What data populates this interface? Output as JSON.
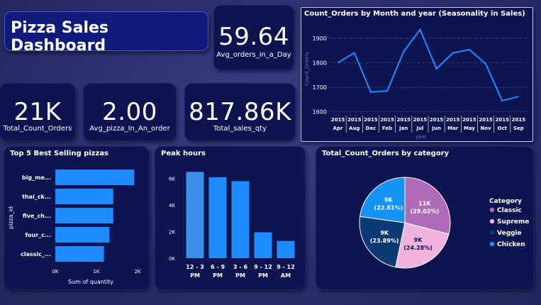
{
  "dashboard_title": "Pizza Sales Dashboard",
  "kpis": {
    "avg_orders_day": {
      "value": "59.64",
      "label": "Avg_orders_in_a_Day"
    },
    "total_orders": {
      "value": "21K",
      "label": "Total_Count_Orders"
    },
    "avg_pizza_order": {
      "value": "2.00",
      "label": "Avg_pizza_In_An_order"
    },
    "total_sales_qty": {
      "value": "817.86K",
      "label": "Total_sales_qty"
    }
  },
  "colors": {
    "bar": "#1e8cff",
    "bar_peak": "#3b8fe8",
    "classic": "#b06bb8",
    "supreme": "#f0b3dd",
    "veggie": "#0c3a75",
    "chicken": "#1592f5",
    "line": "#1e8cff"
  },
  "chart_data": [
    {
      "type": "line",
      "title": "Count_Orders by Month and year (Seasonality in Sales)",
      "x_year": [
        "2015",
        "2015",
        "2015",
        "2015",
        "2015",
        "2015",
        "2015",
        "2015",
        "2015",
        "2015",
        "2015",
        "2015"
      ],
      "x": [
        "Apr",
        "Aug",
        "Dec",
        "Feb",
        "Jan",
        "Jul",
        "Jun",
        "Mar",
        "May",
        "Nov",
        "Oct",
        "Sep"
      ],
      "values": [
        1800,
        1840,
        1680,
        1685,
        1845,
        1935,
        1775,
        1840,
        1853,
        1795,
        1645,
        1662
      ],
      "yticks": [
        1600,
        1700,
        1800,
        1900
      ],
      "ylim": [
        1590,
        1960
      ],
      "xlabel": "year",
      "ylabel": "Count_Orders"
    },
    {
      "type": "bar",
      "orientation": "horizontal",
      "title": "Top 5 Best Selling pizzas",
      "categories": [
        "big_me...",
        "thai_ck...",
        "five_ch...",
        "four_c...",
        "classic_..."
      ],
      "values": [
        1914,
        1410,
        1409,
        1316,
        1181
      ],
      "xticks": [
        "0K",
        "1K",
        "2K"
      ],
      "xlim": [
        0,
        2000
      ],
      "xlabel": "Sum of quantity",
      "ylabel": "pizza_id"
    },
    {
      "type": "bar",
      "title": "Peak hours",
      "categories": [
        [
          "12 - 3",
          "PM"
        ],
        [
          "6 - 9",
          "PM"
        ],
        [
          "3 - 6",
          "PM"
        ],
        [
          "9 - 12",
          "PM"
        ],
        [
          "9 - 12",
          "AM"
        ]
      ],
      "values": [
        6500,
        6100,
        5800,
        1950,
        1300
      ],
      "yticks": [
        "0K",
        "2K",
        "4K",
        "6K"
      ],
      "ylim": [
        0,
        7000
      ]
    },
    {
      "type": "pie",
      "title": "Total_Count_Orders by category",
      "legend_title": "Category",
      "slices": [
        {
          "name": "Classic",
          "value": 29.02,
          "label1": "11K",
          "label2": "(29.02%)"
        },
        {
          "name": "Supreme",
          "value": 24.28,
          "label1": "9K",
          "label2": "(24.28%)"
        },
        {
          "name": "Veggie",
          "value": 23.89,
          "label1": "9K",
          "label2": "(23.89%)"
        },
        {
          "name": "Chicken",
          "value": 22.81,
          "label1": "9K",
          "label2": "(22.81%)"
        }
      ]
    }
  ]
}
